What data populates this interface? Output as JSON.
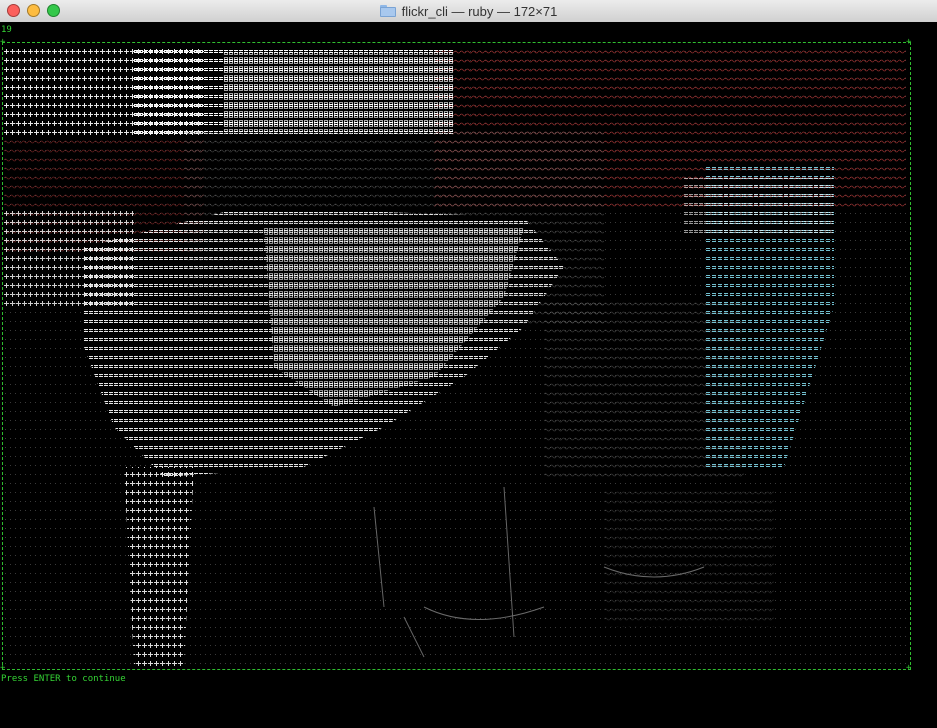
{
  "window": {
    "title": "flickr_cli — ruby — 172×71"
  },
  "terminal": {
    "counter": "19",
    "prompt": "Press ENTER to continue",
    "colors": {
      "text": "#35d535",
      "frame": "#2fbf2f",
      "background": "#000000"
    }
  }
}
